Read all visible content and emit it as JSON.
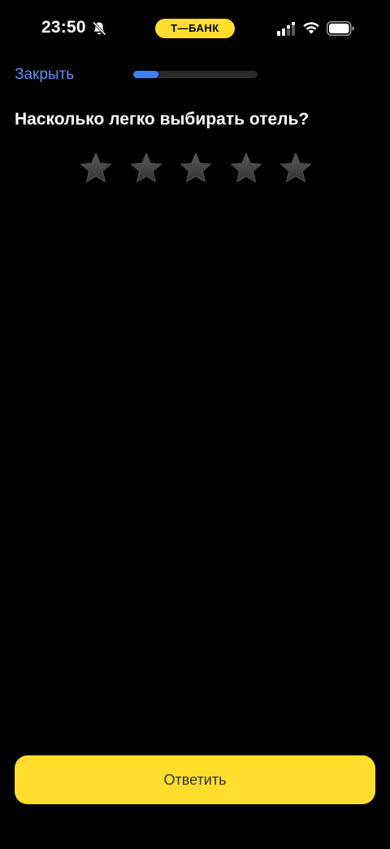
{
  "status_bar": {
    "time": "23:50",
    "brand": "Т—БАНК",
    "icons": {
      "bell": "bell-off-icon",
      "signal": "signal-icon",
      "wifi": "wifi-icon",
      "battery": "battery-icon"
    }
  },
  "header": {
    "close_label": "Закрыть",
    "progress": 0.2
  },
  "survey": {
    "question": "Насколько легко выбирать отель?",
    "rating": {
      "max": 5,
      "value": 0,
      "star_icon": "star-icon"
    }
  },
  "footer": {
    "answer_label": "Ответить"
  },
  "colors": {
    "background": "#000000",
    "accent_yellow": "#ffdd2d",
    "link_blue": "#5b8ff5",
    "progress_blue": "#3d82f0",
    "progress_track": "#2a2a2c",
    "star_inactive": "#4a4a4a"
  }
}
